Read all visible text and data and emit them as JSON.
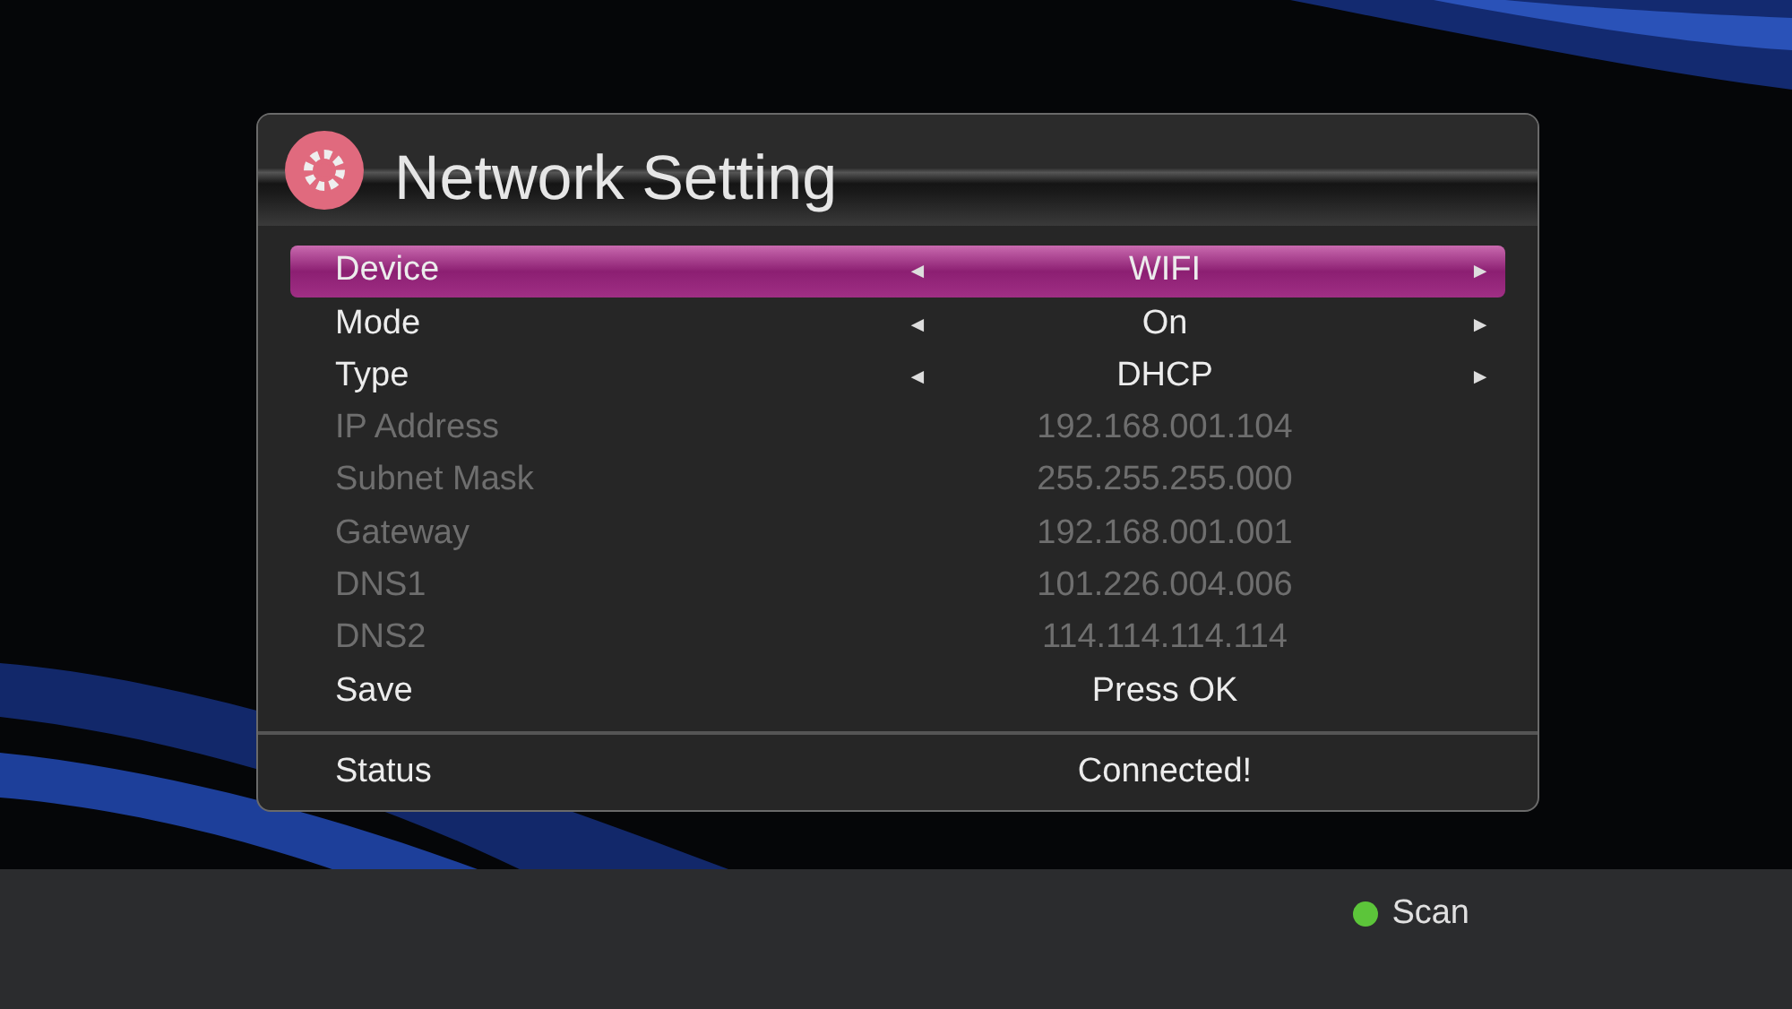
{
  "dialog": {
    "title": "Network Setting",
    "rows": [
      {
        "kind": "select",
        "label": "Device",
        "value": "WIFI",
        "left_arrow": "◄",
        "right_arrow": "►",
        "selected": true,
        "disabled": false
      },
      {
        "kind": "select",
        "label": "Mode",
        "value": "On",
        "left_arrow": "◄",
        "right_arrow": "►",
        "selected": false,
        "disabled": false
      },
      {
        "kind": "select",
        "label": "Type",
        "value": "DHCP",
        "left_arrow": "◄",
        "right_arrow": "►",
        "selected": false,
        "disabled": false
      },
      {
        "kind": "value",
        "label": "IP Address",
        "value": "192.168.001.104",
        "selected": false,
        "disabled": true
      },
      {
        "kind": "value",
        "label": "Subnet Mask",
        "value": "255.255.255.000",
        "selected": false,
        "disabled": true
      },
      {
        "kind": "value",
        "label": "Gateway",
        "value": "192.168.001.001",
        "selected": false,
        "disabled": true
      },
      {
        "kind": "value",
        "label": "DNS1",
        "value": "101.226.004.006",
        "selected": false,
        "disabled": true
      },
      {
        "kind": "value",
        "label": "DNS2",
        "value": "114.114.114.114",
        "selected": false,
        "disabled": true
      },
      {
        "kind": "value",
        "label": "Save",
        "value": "Press OK",
        "selected": false,
        "disabled": false
      }
    ],
    "status": {
      "label": "Status",
      "value": "Connected!"
    }
  },
  "footer": {
    "buttons": [
      {
        "label": "Scan",
        "color": "#5cc53a"
      }
    ]
  }
}
